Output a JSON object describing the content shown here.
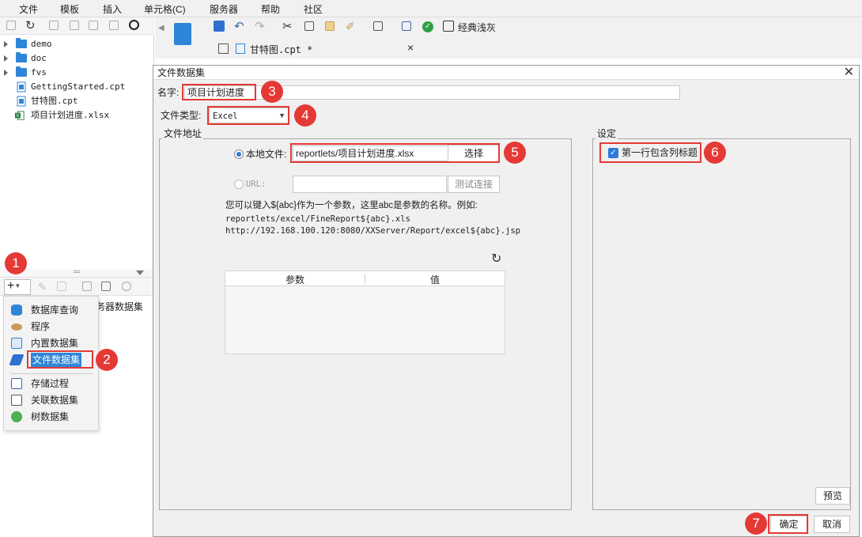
{
  "menu": [
    "文件",
    "模板",
    "插入",
    "单元格(C)",
    "服务器",
    "帮助",
    "社区"
  ],
  "tree": [
    {
      "label": "demo",
      "type": "folder"
    },
    {
      "label": "doc",
      "type": "folder"
    },
    {
      "label": "fvs",
      "type": "folder"
    },
    {
      "label": "GettingStarted.cpt",
      "type": "cpt"
    },
    {
      "label": "甘特图.cpt",
      "type": "cpt"
    },
    {
      "label": "项目计划进度.xlsx",
      "type": "xlsx"
    }
  ],
  "datasource_panel": {
    "plus_label": "+",
    "hidden_item_fragment": "务器数据集"
  },
  "popup_menu": [
    {
      "label": "数据库查询",
      "icon": "database-icon"
    },
    {
      "label": "程序",
      "icon": "program-icon"
    },
    {
      "label": "内置数据集",
      "icon": "embedded-dataset-icon"
    },
    {
      "label": "文件数据集",
      "icon": "file-dataset-icon",
      "selected": true
    },
    {
      "label": "存储过程",
      "icon": "stored-procedure-icon"
    },
    {
      "label": "关联数据集",
      "icon": "relation-dataset-icon"
    },
    {
      "label": "树数据集",
      "icon": "tree-dataset-icon"
    }
  ],
  "designer": {
    "theme_label": "经典浅灰",
    "tab_label": "甘特图.cpt *"
  },
  "dialog": {
    "title": "文件数据集",
    "name_label": "名字:",
    "name_value": "项目计划进度",
    "filetype_label": "文件类型:",
    "filetype_value": "Excel",
    "file_address_title": "文件地址",
    "local_file_label": "本地文件:",
    "local_file_value": "reportlets/项目计划进度.xlsx",
    "choose_button": "选择",
    "url_label": "URL:",
    "test_connection_button": "测试连接",
    "hint_line1": "您可以键入${abc}作为一个参数，这里abc是参数的名称。例如:",
    "hint_line2": "reportlets/excel/FineReport${abc}.xls",
    "hint_line3": "http://192.168.100.120:8080/XXServer/Report/excel${abc}.jsp",
    "param_header": "参数",
    "value_header": "值",
    "settings_title": "设定",
    "first_row_header_label": "第一行包含列标题",
    "first_row_header_checked": true,
    "preview_button": "预览",
    "ok_button": "确定",
    "cancel_button": "取消"
  },
  "callouts": [
    "1",
    "2",
    "3",
    "4",
    "5",
    "6",
    "7"
  ],
  "colors": {
    "callout": "#e53935",
    "folder": "#2f86d8",
    "accent": "#2f7ad8"
  }
}
